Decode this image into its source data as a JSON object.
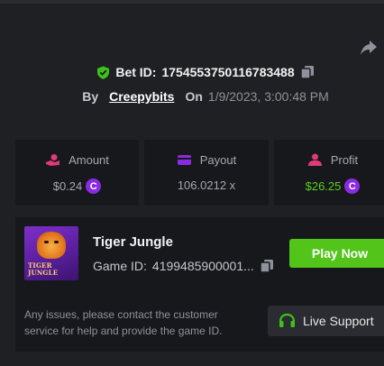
{
  "bet": {
    "label": "Bet ID:",
    "id": "1754553750116783488"
  },
  "author": {
    "by_label": "By",
    "username": "Creepybits",
    "on_label": "On",
    "datetime": "1/9/2023, 3:00:48 PM"
  },
  "stats": {
    "amount": {
      "label": "Amount",
      "value": "$0.24",
      "icon": "coins-hand-icon"
    },
    "payout": {
      "label": "Payout",
      "value": "106.0212 x",
      "icon": "wallet-card-icon"
    },
    "profit": {
      "label": "Profit",
      "value": "$26.25",
      "icon": "user-profit-icon"
    }
  },
  "currency_glyph": "C",
  "game": {
    "title": "Tiger Jungle",
    "id_label": "Game ID:",
    "id_value": "4199485900001...",
    "thumbnail_text": "TIGER JUNGLE",
    "play_label": "Play Now"
  },
  "support": {
    "message": "Any issues, please contact the customer service for help and provide the game ID.",
    "button_label": "Live Support"
  },
  "colors": {
    "background": "#1f2024",
    "panel": "#17181b",
    "accent_green": "#52c41a",
    "profit_green": "#5ad11e",
    "coin_purple": "#8a2be2",
    "icon_pink": "#e03a78",
    "icon_purple": "#8a2be2"
  }
}
